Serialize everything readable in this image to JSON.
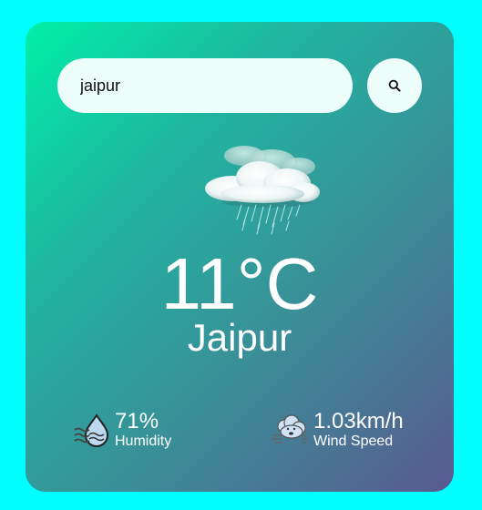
{
  "search": {
    "value": "jaipur",
    "icon": "search-icon"
  },
  "weather": {
    "icon": "rain-cloud-icon",
    "temperature": "11°C",
    "city": "Jaipur"
  },
  "details": {
    "humidity": {
      "icon": "humidity-icon",
      "value": "71%",
      "label": "Humidity"
    },
    "wind": {
      "icon": "wind-icon",
      "value": "1.03km/h",
      "label": "Wind Speed"
    }
  },
  "colors": {
    "page_background": "#00ffff",
    "card_gradient_start": "#00f0a8",
    "card_gradient_end": "#5a5990",
    "input_background": "#ecfdfa",
    "text": "#ffffff"
  }
}
